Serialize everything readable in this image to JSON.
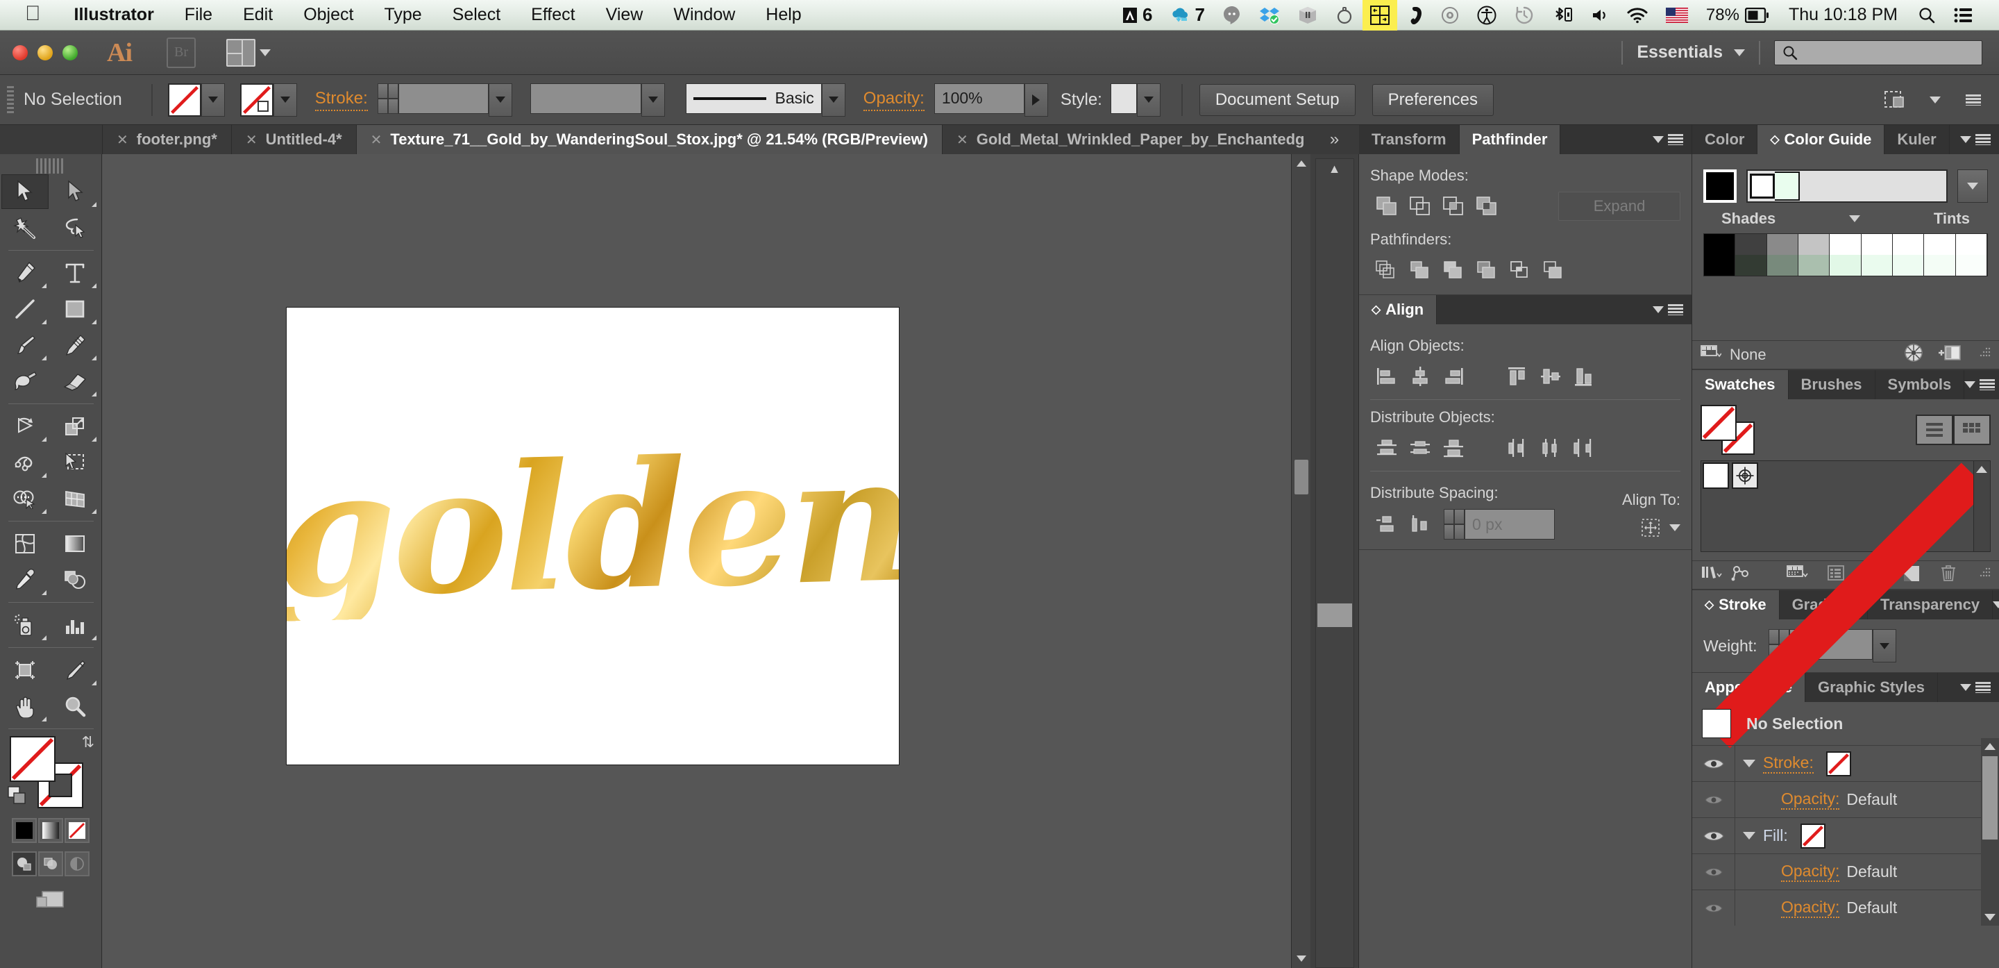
{
  "macmenu": {
    "apple_icon": "apple-icon",
    "items": [
      {
        "label": "Illustrator",
        "bold": true
      },
      {
        "label": "File",
        "bold": false
      },
      {
        "label": "Edit",
        "bold": false
      },
      {
        "label": "Object",
        "bold": false
      },
      {
        "label": "Type",
        "bold": false
      },
      {
        "label": "Select",
        "bold": false
      },
      {
        "label": "Effect",
        "bold": false
      },
      {
        "label": "View",
        "bold": false
      },
      {
        "label": "Window",
        "bold": false
      },
      {
        "label": "Help",
        "bold": false
      }
    ],
    "status": {
      "adobe_badge_count": "6",
      "creative_cloud_count": "7",
      "battery_percent": "78%",
      "clock": "Thu 10:18 PM"
    },
    "status_icons": [
      "adobe-cc-icon",
      "creative-cloud-sync-icon",
      "hangouts-icon",
      "dropbox-icon",
      "box-icon",
      "timer-icon",
      "moom-icon",
      "phone-icon",
      "dvd-icon",
      "accessibility-icon",
      "timemachine-icon",
      "bluetooth-icon",
      "volume-icon",
      "wifi-icon",
      "us-flag-icon",
      "battery-icon",
      "spotlight-search-icon",
      "notification-center-icon"
    ]
  },
  "apptitle": {
    "app_name": "Ai",
    "bridge_label": "Br",
    "arrange_documents": "arrange-documents-icon",
    "workspace": "Essentials",
    "search_placeholder": ""
  },
  "controlbar": {
    "selection_status": "No Selection",
    "fill_label": "fill-swatch",
    "stroke_swatch_label": "stroke-swatch",
    "stroke_label": "Stroke:",
    "stroke_weight_value": "",
    "variable_width_value": "",
    "brush_definition": "Basic",
    "opacity_label": "Opacity:",
    "opacity_value": "100%",
    "style_label": "Style:",
    "document_setup": "Document Setup",
    "preferences": "Preferences"
  },
  "tabs": [
    {
      "title": "footer.png*",
      "active": false
    },
    {
      "title": "Untitled-4*",
      "active": false
    },
    {
      "title": "Texture_71__Gold_by_WanderingSoul_Stox.jpg* @ 21.54% (RGB/Preview)",
      "active": true
    },
    {
      "title": "Gold_Metal_Wrinkled_Paper_by_Enchantedg",
      "active": false
    }
  ],
  "tab_overflow": "»",
  "tools": [
    {
      "name": "selection-tool",
      "glyph": "selection",
      "selected": true,
      "has_submenu": false
    },
    {
      "name": "direct-selection-tool",
      "glyph": "direct-selection",
      "selected": false,
      "has_submenu": true
    },
    {
      "name": "magic-wand-tool",
      "glyph": "magic-wand",
      "selected": false,
      "has_submenu": false
    },
    {
      "name": "lasso-tool",
      "glyph": "lasso",
      "selected": false,
      "has_submenu": false
    },
    {
      "name": "pen-tool",
      "glyph": "pen",
      "selected": false,
      "has_submenu": true
    },
    {
      "name": "type-tool",
      "glyph": "type",
      "selected": false,
      "has_submenu": true
    },
    {
      "name": "line-segment-tool",
      "glyph": "line",
      "selected": false,
      "has_submenu": true
    },
    {
      "name": "rectangle-tool",
      "glyph": "rectangle",
      "selected": false,
      "has_submenu": true
    },
    {
      "name": "paintbrush-tool",
      "glyph": "paintbrush",
      "selected": false,
      "has_submenu": true
    },
    {
      "name": "pencil-tool",
      "glyph": "pencil",
      "selected": false,
      "has_submenu": true
    },
    {
      "name": "blob-brush-tool",
      "glyph": "blob-brush",
      "selected": false,
      "has_submenu": false
    },
    {
      "name": "eraser-tool",
      "glyph": "eraser",
      "selected": false,
      "has_submenu": true
    },
    {
      "name": "rotate-tool",
      "glyph": "rotate",
      "selected": false,
      "has_submenu": true
    },
    {
      "name": "scale-tool",
      "glyph": "scale",
      "selected": false,
      "has_submenu": true
    },
    {
      "name": "width-tool",
      "glyph": "width",
      "selected": false,
      "has_submenu": true
    },
    {
      "name": "free-transform-tool",
      "glyph": "free-transform",
      "selected": false,
      "has_submenu": false
    },
    {
      "name": "shape-builder-tool",
      "glyph": "shape-builder",
      "selected": false,
      "has_submenu": true
    },
    {
      "name": "perspective-grid-tool",
      "glyph": "perspective-grid",
      "selected": false,
      "has_submenu": true
    },
    {
      "name": "mesh-tool",
      "glyph": "mesh",
      "selected": false,
      "has_submenu": false
    },
    {
      "name": "gradient-tool",
      "glyph": "gradient",
      "selected": false,
      "has_submenu": false
    },
    {
      "name": "eyedropper-tool",
      "glyph": "eyedropper",
      "selected": false,
      "has_submenu": true
    },
    {
      "name": "blend-tool",
      "glyph": "blend",
      "selected": false,
      "has_submenu": false
    },
    {
      "name": "symbol-sprayer-tool",
      "glyph": "symbol-sprayer",
      "selected": false,
      "has_submenu": true
    },
    {
      "name": "column-graph-tool",
      "glyph": "column-graph",
      "selected": false,
      "has_submenu": true
    },
    {
      "name": "artboard-tool",
      "glyph": "artboard",
      "selected": false,
      "has_submenu": false
    },
    {
      "name": "slice-tool",
      "glyph": "slice",
      "selected": false,
      "has_submenu": true
    },
    {
      "name": "hand-tool",
      "glyph": "hand",
      "selected": false,
      "has_submenu": true
    },
    {
      "name": "zoom-tool",
      "glyph": "zoom",
      "selected": false,
      "has_submenu": false
    }
  ],
  "artwork": {
    "word": "golden",
    "gold_light": "#ffe9a0",
    "gold_mid": "#e8b53a",
    "gold_dark": "#b8860b",
    "artboard_background": "#ffffff"
  },
  "pathfinder_panel": {
    "tabs": [
      {
        "label": "Transform",
        "active": false,
        "has_diamond": false
      },
      {
        "label": "Pathfinder",
        "active": true,
        "has_diamond": false
      }
    ],
    "shape_modes_label": "Shape Modes:",
    "shape_mode_icons": [
      "unite-icon",
      "minus-front-icon",
      "intersect-icon",
      "exclude-icon"
    ],
    "expand_label": "Expand",
    "pathfinders_label": "Pathfinders:",
    "pathfinder_icons": [
      "divide-icon",
      "trim-icon",
      "merge-icon",
      "crop-icon",
      "outline-icon",
      "minus-back-icon"
    ]
  },
  "align_panel": {
    "tab_label": "Align",
    "align_objects_label": "Align Objects:",
    "align_object_icons": [
      "align-left-icon",
      "align-horizontal-center-icon",
      "align-right-icon",
      "align-top-icon",
      "align-vertical-center-icon",
      "align-bottom-icon"
    ],
    "distribute_objects_label": "Distribute Objects:",
    "distribute_object_icons": [
      "distribute-top-icon",
      "distribute-vertical-center-icon",
      "distribute-bottom-icon",
      "distribute-left-icon",
      "distribute-horizontal-center-icon",
      "distribute-right-icon"
    ],
    "distribute_spacing_label": "Distribute Spacing:",
    "distribute_spacing_icons": [
      "distribute-vertical-space-icon",
      "distribute-horizontal-space-icon"
    ],
    "spacing_value": "",
    "spacing_placeholder": "0 px",
    "align_to_label": "Align To:",
    "align_to_icon": "align-to-selection-icon"
  },
  "color_panel": {
    "tabs": [
      {
        "label": "Color",
        "active": false,
        "has_diamond": false
      },
      {
        "label": "Color Guide",
        "active": true,
        "has_diamond": true
      },
      {
        "label": "Kuler",
        "active": false,
        "has_diamond": false
      }
    ],
    "base_color": "#000000",
    "harmony_swatch_1": "#ffffff",
    "harmony_swatch_2": "#e9fdee",
    "shades_label": "Shades",
    "tints_label": "Tints",
    "grid_row_1": [
      "#000000",
      "#404040",
      "#8a8a8a",
      "#c4c4c4",
      "#ffffff",
      "#ffffff",
      "#ffffff",
      "#ffffff",
      "#ffffff"
    ],
    "grid_row_2": [
      "#000000",
      "#333b33",
      "#788a7c",
      "#aabfae",
      "#e2f8e7",
      "#eafbee",
      "#eefcf2",
      "#f4fdf6",
      "#fafefb"
    ]
  },
  "swatches_status": {
    "library_icon": "color-library-icon",
    "label": "None",
    "edit_colors_icon": "edit-colors-icon",
    "save_group_icon": "save-color-group-icon",
    "resize_icon": "resize-grip-icon"
  },
  "swatches_panel": {
    "tabs": [
      {
        "label": "Swatches",
        "active": true,
        "has_diamond": false
      },
      {
        "label": "Brushes",
        "active": false,
        "has_diamond": false
      },
      {
        "label": "Symbols",
        "active": false,
        "has_diamond": false
      }
    ],
    "fill_swatch": "none-swatch",
    "stroke_swatch": "none-swatch",
    "view_list_icon": "list-view-icon",
    "view_grid_icon": "grid-view-icon",
    "chips": [
      "none-swatch",
      "registration-swatch"
    ],
    "footer_icons": [
      "swatch-libraries-icon",
      "show-libraries-icon",
      "swatch-kinds-icon",
      "swatch-options-icon",
      "new-color-group-icon",
      "new-swatch-icon",
      "delete-swatch-icon"
    ]
  },
  "stroke_panel": {
    "tabs": [
      {
        "label": "Stroke",
        "active": true,
        "has_diamond": true
      },
      {
        "label": "Gradient",
        "active": false,
        "has_diamond": false
      },
      {
        "label": "Transparency",
        "active": false,
        "has_diamond": false
      }
    ],
    "weight_label": "Weight:",
    "weight_value": ""
  },
  "appearance_panel": {
    "tabs": [
      {
        "label": "Appearance",
        "active": true,
        "has_diamond": false
      },
      {
        "label": "Graphic Styles",
        "active": false,
        "has_diamond": false
      }
    ],
    "header_title": "No Selection",
    "rows": [
      {
        "key": "Stroke:",
        "value": "",
        "has_swatch": true,
        "indent": 0,
        "eye": "on",
        "triangle": true
      },
      {
        "key": "Opacity:",
        "value": "Default",
        "has_swatch": false,
        "indent": 1,
        "eye": "dim",
        "triangle": false
      },
      {
        "key": "Fill:",
        "value": "",
        "has_swatch": true,
        "indent": 0,
        "eye": "on",
        "triangle": true
      },
      {
        "key": "Opacity:",
        "value": "Default",
        "has_swatch": false,
        "indent": 1,
        "eye": "dim",
        "triangle": false
      },
      {
        "key": "Opacity:",
        "value": "Default",
        "has_swatch": false,
        "indent": 1,
        "eye": "dim",
        "triangle": false
      }
    ]
  }
}
